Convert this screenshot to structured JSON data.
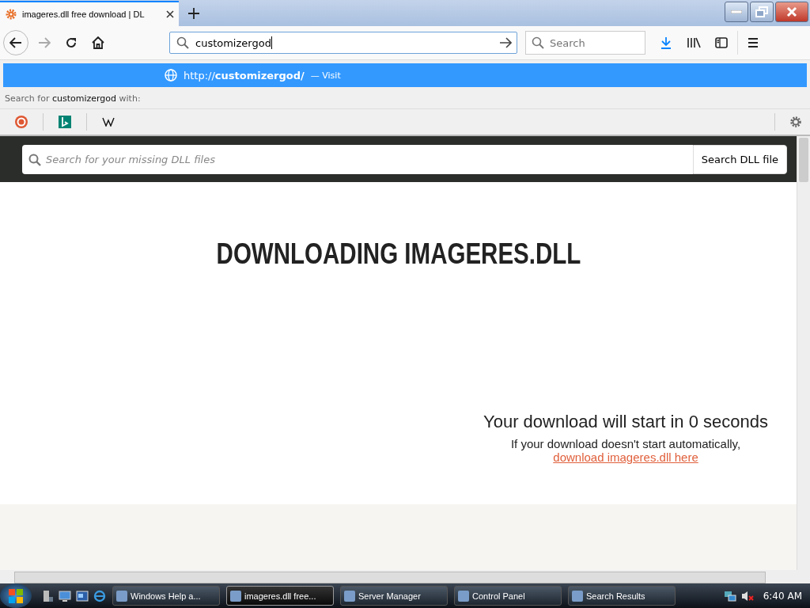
{
  "tab": {
    "title": "imageres.dll free download | DL",
    "selected": true
  },
  "url_bar": {
    "value": "customizergod"
  },
  "search_bar": {
    "placeholder": "Search"
  },
  "suggestion": {
    "text": "http://**customizergod/**",
    "action": "— Visit"
  },
  "search_with": {
    "text": "Search for **customizergod** with:"
  },
  "page": {
    "search_placeholder": "Search for your missing DLL files",
    "search_button": "Search DLL file",
    "heading": "DOWNLOADING IMAGERES.DLL",
    "countdown": "Your download will start in 0 seconds",
    "fallback": "If your download doesn't start automatically,",
    "link": "download imageres.dll here"
  },
  "taskbar": {
    "items": [
      {
        "label": "Windows Help a...",
        "selected": false
      },
      {
        "label": "imageres.dll free...",
        "selected": true
      },
      {
        "label": "Server Manager",
        "selected": false
      },
      {
        "label": "Control Panel",
        "selected": false
      },
      {
        "label": "Search Results",
        "selected": false
      }
    ],
    "clock": "6:40 AM"
  }
}
